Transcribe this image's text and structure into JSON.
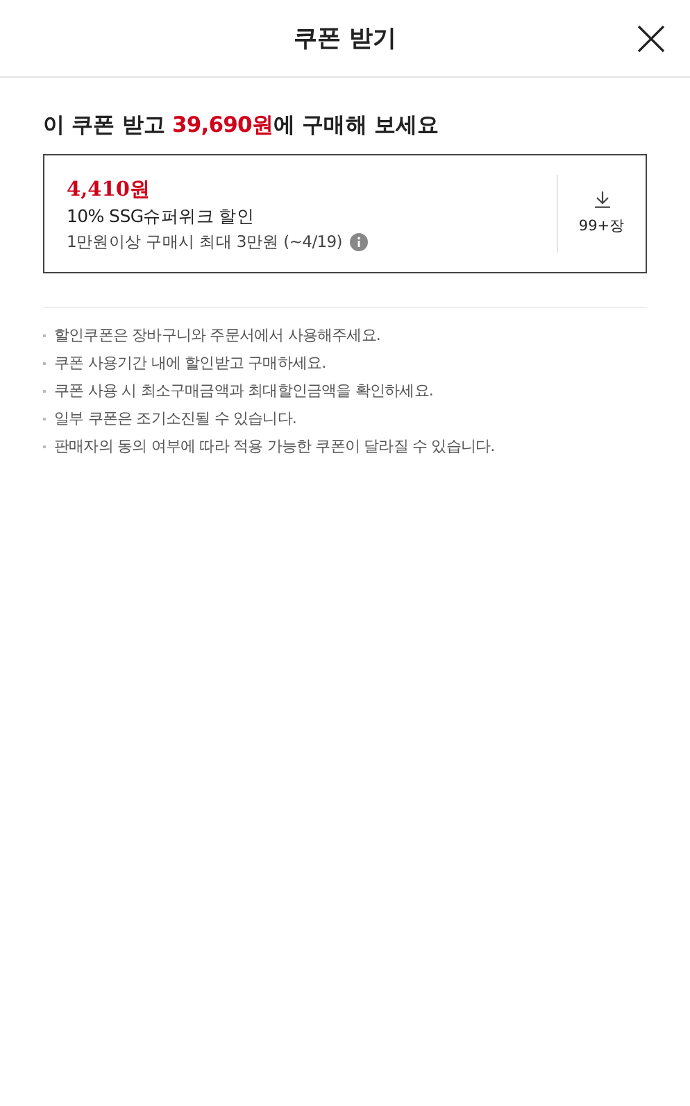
{
  "header": {
    "title": "쿠폰 받기"
  },
  "headline": {
    "before": "이 쿠폰 받고 ",
    "price": "39,690원",
    "after": "에 구매해 보세요"
  },
  "coupon": {
    "amount": "4,410원",
    "name": "10% SSG슈퍼위크 할인",
    "condition": "1만원이상 구매시 최대 3만원 (~4/19)",
    "count": "99+장"
  },
  "notes": [
    "할인쿠폰은 장바구니와 주문서에서 사용해주세요.",
    "쿠폰 사용기간 내에 할인받고 구매하세요.",
    "쿠폰 사용 시 최소구매금액과 최대할인금액을 확인하세요.",
    "일부 쿠폰은 조기소진될 수 있습니다.",
    "판매자의 동의 여부에 따라 적용 가능한 쿠폰이 달라질 수 있습니다."
  ]
}
